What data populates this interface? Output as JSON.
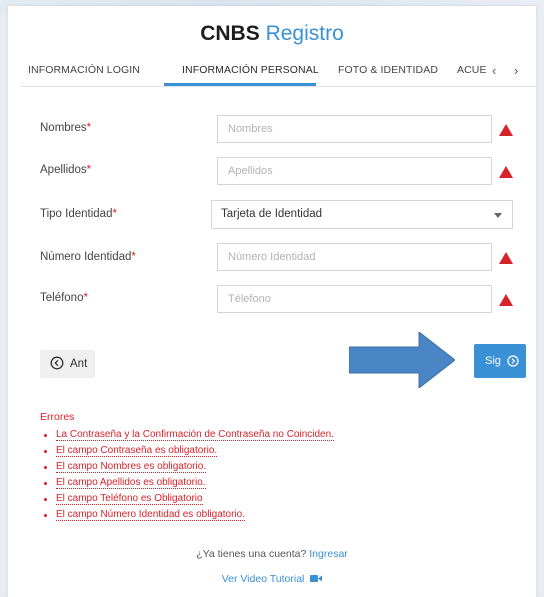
{
  "header": {
    "brand": "CNBS",
    "title": "Registro"
  },
  "tabs": [
    {
      "label": "INFORMACIÓN LOGIN",
      "active": false
    },
    {
      "label": "INFORMACIÓN PERSONAL",
      "active": true
    },
    {
      "label": "FOTO & IDENTIDAD",
      "active": false
    },
    {
      "label": "ACUE",
      "active": false
    }
  ],
  "tab_nav": {
    "prev": "‹",
    "next": "›"
  },
  "form": {
    "fields": [
      {
        "label": "Nombres",
        "required_mark": "*",
        "placeholder": "Nombres",
        "value": "",
        "warning": true
      },
      {
        "label": "Apellidos",
        "required_mark": "*",
        "placeholder": "Apellidos",
        "value": "",
        "warning": true
      },
      {
        "label": "Tipo Identidad",
        "required_mark": "*",
        "selected": "Tarjeta de Identidad"
      },
      {
        "label": "Número Identidad",
        "required_mark": "*",
        "placeholder": "Número Identidad",
        "value": "",
        "warning": true
      },
      {
        "label": "Teléfono",
        "required_mark": "*",
        "placeholder": "Télefono",
        "value": "",
        "warning": true
      }
    ]
  },
  "buttons": {
    "back": "Ant",
    "next": "Sig"
  },
  "errors": {
    "title": "Errores",
    "items": [
      "La Contraseña y la Confirmación de Contraseña no Coinciden.",
      "El campo Contraseña es obligatorio.",
      "El campo Nombres es obligatorio.",
      "El campo Apellidos es obligatorio.",
      "El campo Teléfono es Obligatorio",
      "El campo Número Identidad es obligatorio."
    ]
  },
  "footer": {
    "question": "¿Ya tienes una cuenta?",
    "login_link": "Ingresar",
    "tutorial_link": "Ver Video Tutorial"
  },
  "colors": {
    "accent": "#3a91d6",
    "error": "#d8232a",
    "arrow": "#4a86c5"
  },
  "icons": {
    "warning": "warning-triangle-icon",
    "back": "circle-chevron-left-icon",
    "next": "circle-chevron-right-icon",
    "video": "video-camera-icon"
  }
}
